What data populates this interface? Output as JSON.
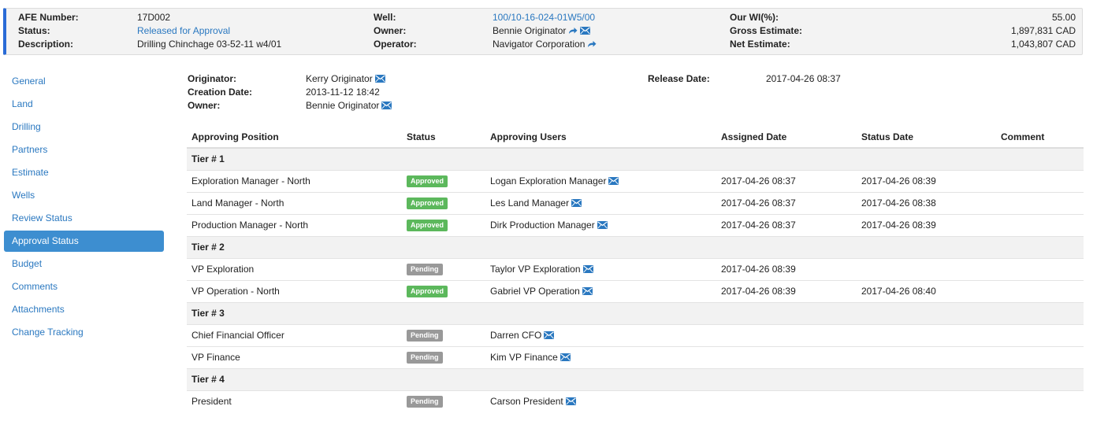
{
  "summary": {
    "afe_number_label": "AFE Number:",
    "afe_number": "17D002",
    "status_label": "Status:",
    "status": "Released for Approval",
    "description_label": "Description:",
    "description": "Drilling Chinchage 03-52-11 w4/01",
    "well_label": "Well:",
    "well": "100/10-16-024-01W5/00",
    "owner_label": "Owner:",
    "owner": "Bennie Originator",
    "operator_label": "Operator:",
    "operator": "Navigator Corporation",
    "wi_label": "Our WI(%):",
    "wi": "55.00",
    "gross_label": "Gross Estimate:",
    "gross": "1,897,831 CAD",
    "net_label": "Net Estimate:",
    "net": "1,043,807 CAD"
  },
  "sidebar": {
    "items": [
      {
        "label": "General"
      },
      {
        "label": "Land"
      },
      {
        "label": "Drilling"
      },
      {
        "label": "Partners"
      },
      {
        "label": "Estimate"
      },
      {
        "label": "Wells"
      },
      {
        "label": "Review Status"
      },
      {
        "label": "Approval Status",
        "active": true
      },
      {
        "label": "Budget"
      },
      {
        "label": "Comments"
      },
      {
        "label": "Attachments"
      },
      {
        "label": "Change Tracking"
      }
    ]
  },
  "info": {
    "originator_label": "Originator:",
    "originator": "Kerry Originator",
    "creation_label": "Creation Date:",
    "creation": "2013-11-12 18:42",
    "owner_label": "Owner:",
    "owner": "Bennie Originator",
    "release_label": "Release Date:",
    "release": "2017-04-26 08:37"
  },
  "table": {
    "headers": [
      "Approving Position",
      "Status",
      "Approving Users",
      "Assigned Date",
      "Status Date",
      "Comment"
    ],
    "tiers": [
      {
        "label": "Tier # 1",
        "rows": [
          {
            "position": "Exploration Manager - North",
            "status": "Approved",
            "user": "Logan Exploration Manager",
            "assigned": "2017-04-26 08:37",
            "status_date": "2017-04-26 08:39",
            "comment": ""
          },
          {
            "position": "Land Manager - North",
            "status": "Approved",
            "user": "Les Land Manager",
            "assigned": "2017-04-26 08:37",
            "status_date": "2017-04-26 08:38",
            "comment": ""
          },
          {
            "position": "Production Manager - North",
            "status": "Approved",
            "user": "Dirk Production Manager",
            "assigned": "2017-04-26 08:37",
            "status_date": "2017-04-26 08:39",
            "comment": ""
          }
        ]
      },
      {
        "label": "Tier # 2",
        "rows": [
          {
            "position": "VP Exploration",
            "status": "Pending",
            "user": "Taylor VP Exploration",
            "assigned": "2017-04-26 08:39",
            "status_date": "",
            "comment": ""
          },
          {
            "position": "VP Operation - North",
            "status": "Approved",
            "user": "Gabriel VP Operation",
            "assigned": "2017-04-26 08:39",
            "status_date": "2017-04-26 08:40",
            "comment": ""
          }
        ]
      },
      {
        "label": "Tier # 3",
        "rows": [
          {
            "position": "Chief Financial Officer",
            "status": "Pending",
            "user": "Darren CFO",
            "assigned": "",
            "status_date": "",
            "comment": ""
          },
          {
            "position": "VP Finance",
            "status": "Pending",
            "user": "Kim VP Finance",
            "assigned": "",
            "status_date": "",
            "comment": ""
          }
        ]
      },
      {
        "label": "Tier # 4",
        "rows": [
          {
            "position": "President",
            "status": "Pending",
            "user": "Carson President",
            "assigned": "",
            "status_date": "",
            "comment": ""
          }
        ]
      }
    ]
  },
  "colors": {
    "accent_bar": "#2a6bd6",
    "link": "#2a78c0",
    "active_nav": "#3d8ed0",
    "approved": "#5cb85c",
    "pending": "#999999"
  },
  "icons": {
    "mail": "envelope-icon",
    "share": "share-arrow-icon"
  }
}
